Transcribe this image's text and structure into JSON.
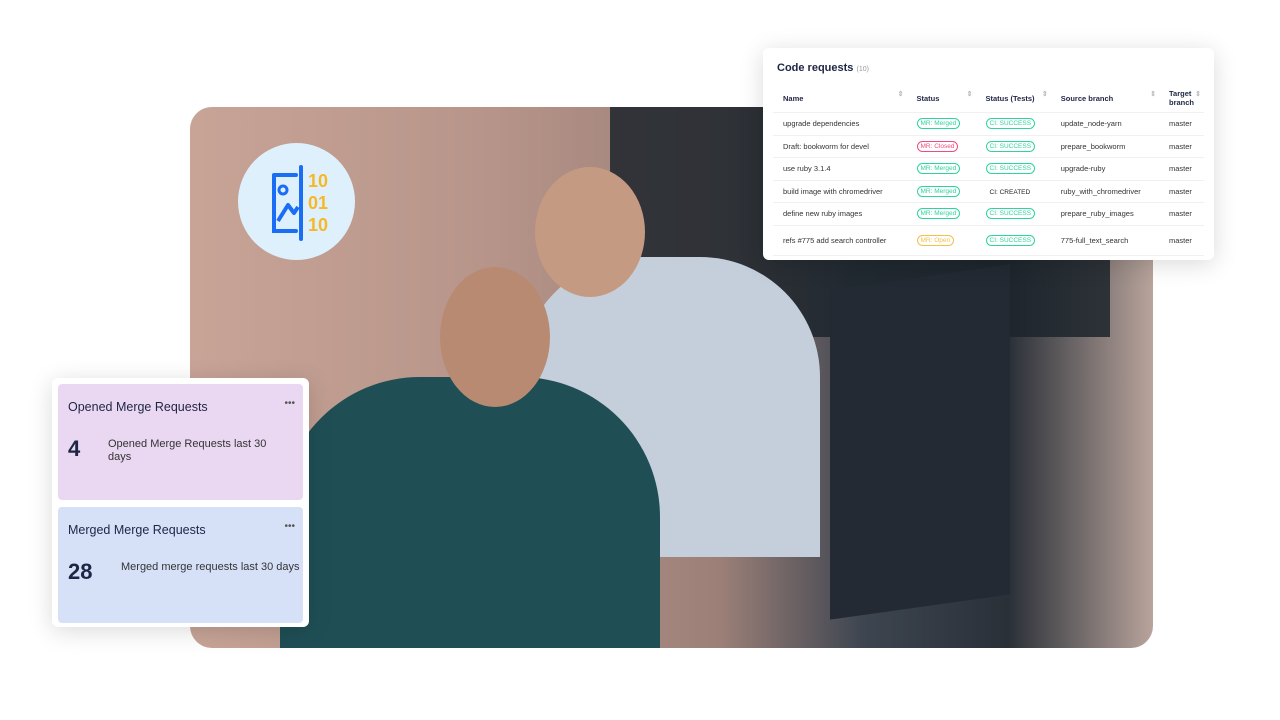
{
  "code_requests": {
    "title": "Code requests",
    "count": "(10)",
    "columns": [
      "Name",
      "Status",
      "Status (Tests)",
      "Source branch",
      "Target branch"
    ],
    "rows": [
      {
        "name": "upgrade dependencies",
        "status": "MR: Merged",
        "tests": "CI: SUCCESS",
        "source": "update_node-yarn",
        "target": "master"
      },
      {
        "name": "Draft: bookworm for devel",
        "status": "MR: Closed",
        "tests": "CI: SUCCESS",
        "source": "prepare_bookworm",
        "target": "master"
      },
      {
        "name": "use ruby 3.1.4",
        "status": "MR: Merged",
        "tests": "CI: SUCCESS",
        "source": "upgrade-ruby",
        "target": "master"
      },
      {
        "name": "build image with chromedriver",
        "status": "MR: Merged",
        "tests": "CI: CREATED",
        "source": "ruby_with_chromedriver",
        "target": "master"
      },
      {
        "name": "define new ruby images",
        "status": "MR: Merged",
        "tests": "CI: SUCCESS",
        "source": "prepare_ruby_images",
        "target": "master"
      },
      {
        "name": "refs #775 add search controller",
        "status": "MR: Open",
        "tests": "CI: SUCCESS",
        "source": "775-full_text_search",
        "target": "master"
      }
    ]
  },
  "status_colors": {
    "MR: Merged": "#2fd49a",
    "MR: Closed": "#f04b7e",
    "MR: Open": "#f5c04a",
    "CI: SUCCESS": "#2fd49a"
  },
  "stats": [
    {
      "title": "Opened Merge Requests",
      "value": "4",
      "desc": "Opened Merge Requests last 30 days",
      "bg": "#ead8f2"
    },
    {
      "title": "Merged Merge Requests",
      "value": "28",
      "desc": "Merged merge requests last 30 days",
      "bg": "#d6e1f8"
    }
  ],
  "icon": {
    "name": "image-binary-icon",
    "digits": [
      "10",
      "01",
      "10"
    ]
  }
}
